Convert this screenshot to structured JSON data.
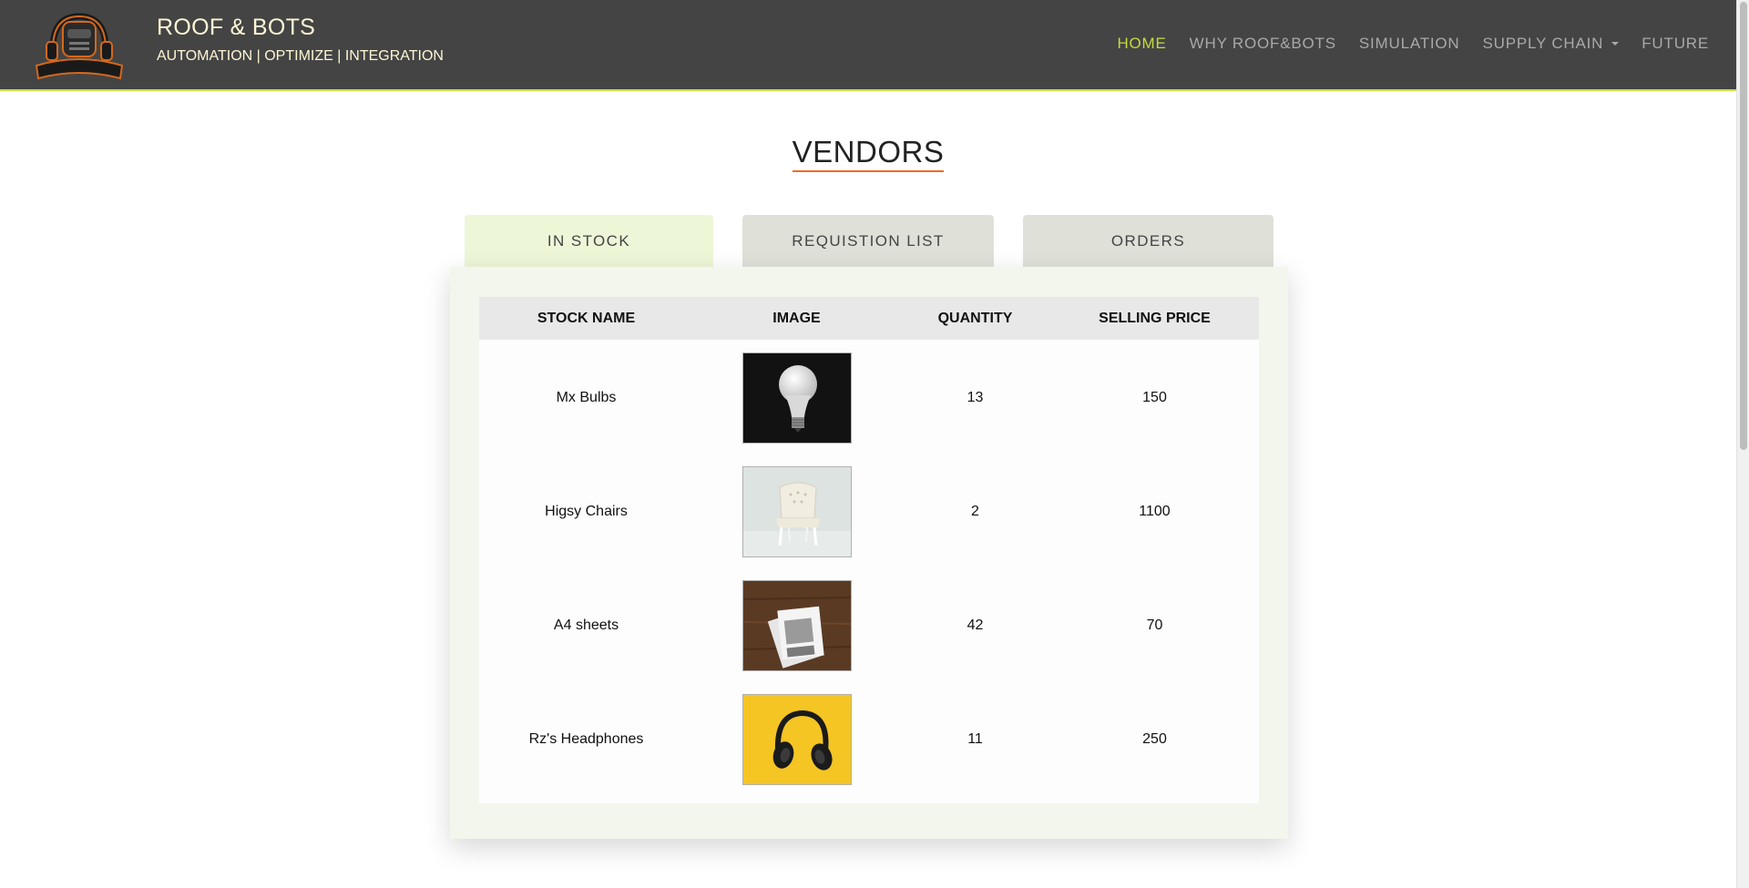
{
  "header": {
    "brand_title": "ROOF & BOTS",
    "tagline": "AUTOMATION | OPTIMIZE | INTEGRATION",
    "logo_text": "ROOF & BOTS",
    "nav": [
      {
        "label": "HOME",
        "active": true
      },
      {
        "label": "WHY ROOF&BOTS",
        "active": false
      },
      {
        "label": "SIMULATION",
        "active": false
      },
      {
        "label": "SUPPLY CHAIN",
        "active": false,
        "dropdown": true
      },
      {
        "label": "FUTURE",
        "active": false
      }
    ],
    "accent_color": "#c6da3e"
  },
  "page": {
    "title": "VENDORS"
  },
  "tabs": [
    {
      "label": "IN STOCK",
      "active": true
    },
    {
      "label": "REQUISTION LIST",
      "active": false
    },
    {
      "label": "ORDERS",
      "active": false
    }
  ],
  "table": {
    "columns": [
      "STOCK NAME",
      "IMAGE",
      "QUANTITY",
      "SELLING PRICE"
    ],
    "rows": [
      {
        "name": "Mx Bulbs",
        "image": "light-bulb-image",
        "quantity": "13",
        "price": "150"
      },
      {
        "name": "Higsy Chairs",
        "image": "chair-image",
        "quantity": "2",
        "price": "1100"
      },
      {
        "name": "A4 sheets",
        "image": "paper-sheets-image",
        "quantity": "42",
        "price": "70"
      },
      {
        "name": "Rz's Headphones",
        "image": "headphones-image",
        "quantity": "11",
        "price": "250"
      }
    ]
  }
}
